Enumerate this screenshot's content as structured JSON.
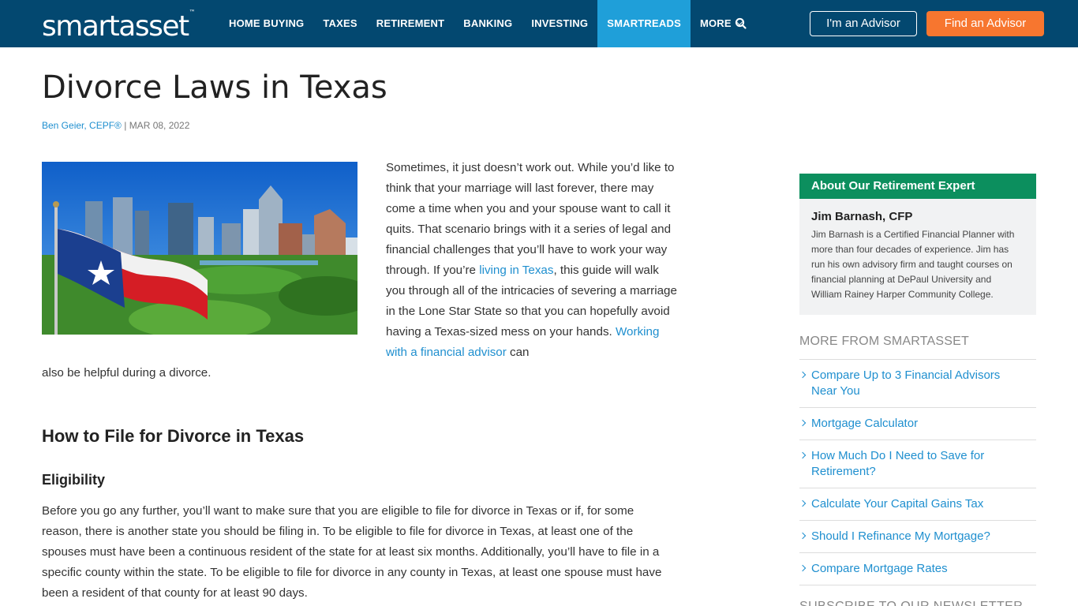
{
  "brand": {
    "logo_text": "smartasset",
    "trademark": "™"
  },
  "nav": {
    "items": [
      {
        "label": "HOME BUYING"
      },
      {
        "label": "TAXES"
      },
      {
        "label": "RETIREMENT"
      },
      {
        "label": "BANKING"
      },
      {
        "label": "INVESTING"
      },
      {
        "label": "SMARTREADS",
        "active": true
      },
      {
        "label": "MORE"
      }
    ],
    "search_icon": "search-icon",
    "advisor_button": "I'm an Advisor",
    "find_button": "Find an Advisor"
  },
  "article": {
    "title": "Divorce Laws in Texas",
    "author": "Ben Geier, CEPF®",
    "separator": " | ",
    "date": "MAR 08, 2022",
    "intro_part1": "Sometimes, it just doesn’t work out. While you’d like to think that your marriage will last forever, there may come a time when you and your spouse want to call it quits. That scenario brings with it a series of legal and financial challenges that you’ll have to work your way through. If you’re ",
    "intro_link1": "living in Texas",
    "intro_part2": ", this guide will walk you through all of the intricacies of severing a marriage in the Lone Star State so that you can hopefully avoid having a Texas-sized mess on your hands. ",
    "intro_link2": "Working with a financial advisor",
    "intro_part3": " can",
    "intro_tail": "also be helpful during a divorce.",
    "h2": "How to File for Divorce in Texas",
    "h3": "Eligibility",
    "eligibility_para": "Before you go any further, you’ll want to make sure that you are eligible to file for divorce in Texas or if, for some reason, there is another state you should be filing in. To be eligible to file for divorce in Texas, at least one of the spouses must have been a continuous resident of the state for at least six months. Additionally, you’ll have to file in a specific county within the state. To be eligible to file for divorce in any county in Texas, at least one spouse must have been a resident of that county for at least 90 days."
  },
  "sidebar": {
    "expert_heading": "About Our Retirement Expert",
    "expert_name": "Jim Barnash, CFP",
    "expert_bio": "Jim Barnash is a Certified Financial Planner with more than four decades of experience. Jim has run his own advisory firm and taught courses on financial planning at DePaul University and William Rainey Harper Community College.",
    "more_title": "MORE FROM SMARTASSET",
    "more_links": [
      "Compare Up to 3 Financial Advisors Near You",
      "Mortgage Calculator",
      "How Much Do I Need to Save for Retirement?",
      "Calculate Your Capital Gains Tax",
      "Should I Refinance My Mortgage?",
      "Compare Mortgage Rates"
    ],
    "newsletter_title": "SUBSCRIBE TO OUR NEWSLETTER"
  },
  "colors": {
    "header": "#034870",
    "active_nav": "#1f9fd9",
    "cta_orange": "#f7762f",
    "expert_green": "#0c8f5e",
    "link_blue": "#1f8fcf"
  }
}
